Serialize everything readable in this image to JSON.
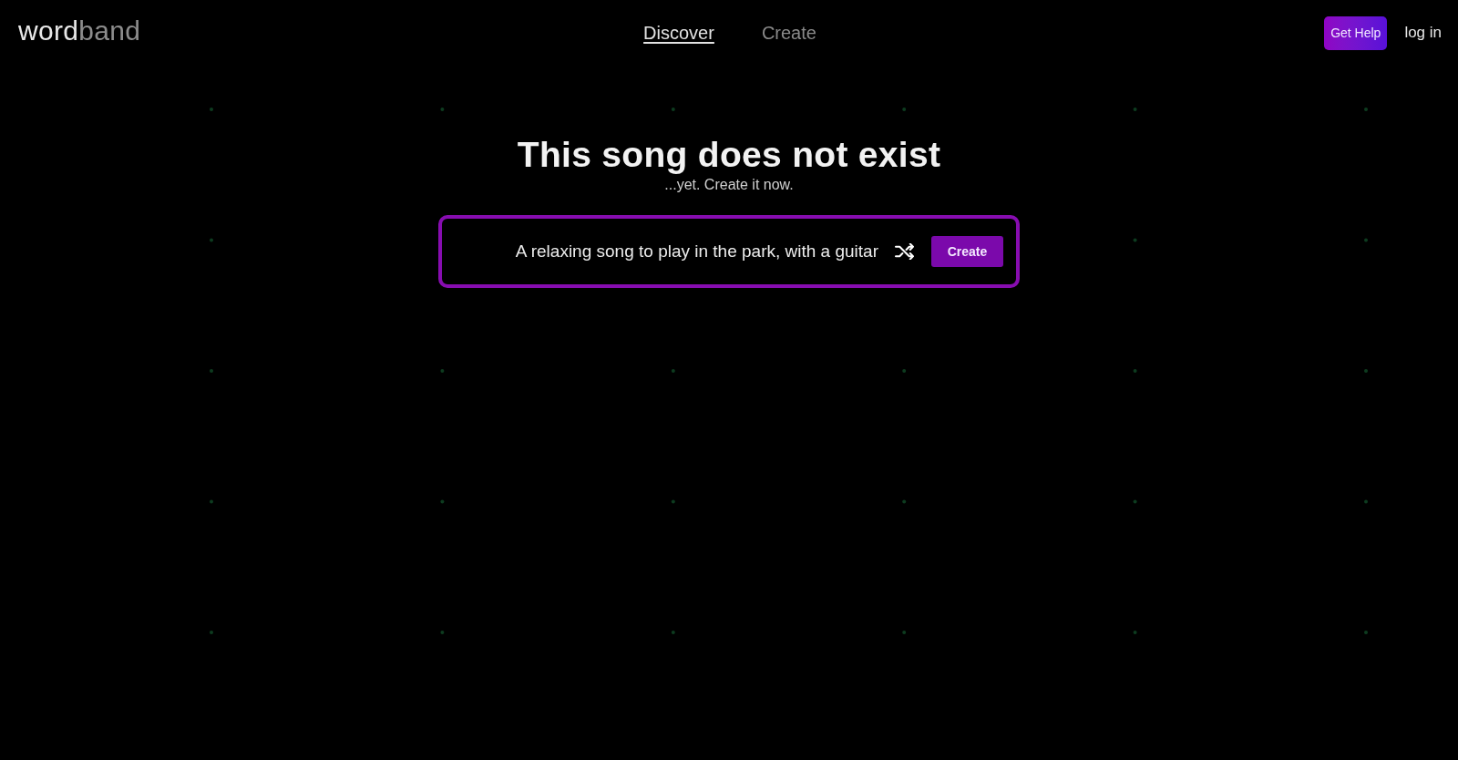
{
  "header": {
    "logo": [
      {
        "text": "word",
        "kind": "bright"
      },
      {
        "text": "band",
        "kind": "dim"
      }
    ],
    "nav": [
      {
        "label": "Discover",
        "selected": true
      },
      {
        "label": "Create",
        "selected": false
      }
    ],
    "help_button": "Get Help",
    "login_link": "log in"
  },
  "hero": {
    "title": "This song does not exist",
    "subtitle": "...yet. Create it now."
  },
  "prompt": {
    "value": "A relaxing song to play in the park, with a guitar",
    "create_button": "Create"
  }
}
